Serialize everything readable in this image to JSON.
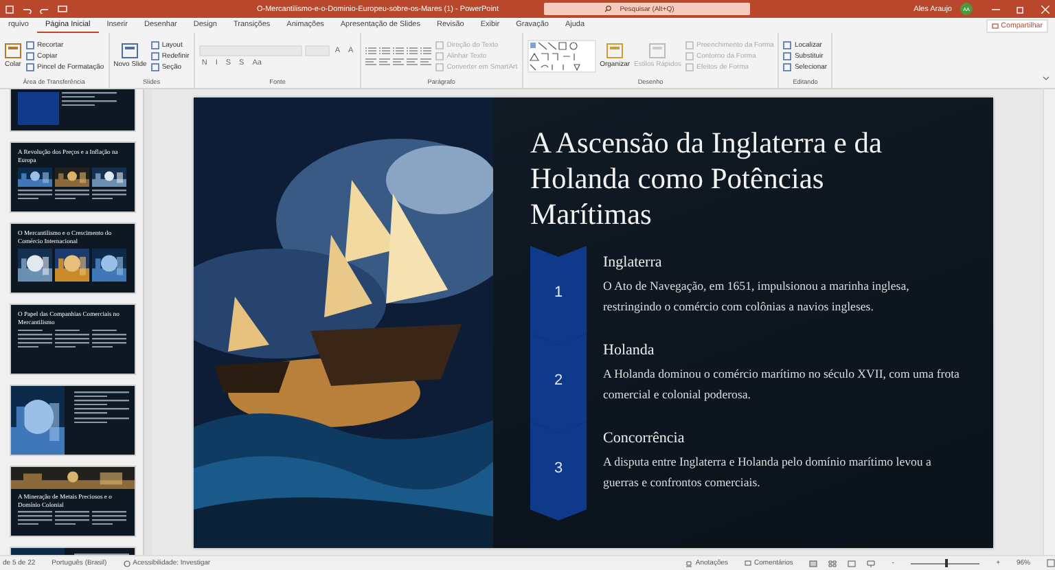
{
  "window": {
    "title": "O-Mercantilismo-e-o-Dominio-Europeu-sobre-os-Mares (1)  -  PowerPoint",
    "search": {
      "placeholder": "Pesquisar (Alt+Q)"
    },
    "user": {
      "name": "Ales Araujo",
      "initials": "AA"
    }
  },
  "tabs": [
    {
      "label": "rquivo",
      "selected": false
    },
    {
      "label": "Página Inicial",
      "selected": true
    },
    {
      "label": "Inserir",
      "selected": false
    },
    {
      "label": "Desenhar",
      "selected": false
    },
    {
      "label": "Design",
      "selected": false
    },
    {
      "label": "Transições",
      "selected": false
    },
    {
      "label": "Animações",
      "selected": false
    },
    {
      "label": "Apresentação de Slides",
      "selected": false
    },
    {
      "label": "Revisão",
      "selected": false
    },
    {
      "label": "Exibir",
      "selected": false
    },
    {
      "label": "Gravação",
      "selected": false
    },
    {
      "label": "Ajuda",
      "selected": false
    }
  ],
  "share_button": "Compartilhar",
  "ribbon": {
    "groups": [
      {
        "kind": "clipboard",
        "label": "Área de Transferência",
        "large": {
          "label": "Colar",
          "disabled": false
        },
        "items": [
          {
            "label": "Recortar",
            "disabled": false
          },
          {
            "label": "Copiar",
            "disabled": false
          },
          {
            "label": "Pincel de Formatação",
            "disabled": false
          }
        ]
      },
      {
        "kind": "slides",
        "label": "Slides",
        "large": {
          "label": "Novo Slide",
          "disabled": false
        },
        "items": [
          {
            "label": "Layout",
            "disabled": false
          },
          {
            "label": "Redefinir",
            "disabled": false
          },
          {
            "label": "Seção",
            "disabled": false
          }
        ]
      },
      {
        "kind": "font",
        "label": "Fonte",
        "glyphs_top": [
          "A",
          "A"
        ],
        "glyphs_bottom": [
          "N",
          "I",
          "S",
          "S",
          "Aa"
        ]
      },
      {
        "kind": "paragraph",
        "label": "Parágrafo",
        "items": [
          {
            "label": "Direção do Texto",
            "disabled": true
          },
          {
            "label": "Alinhar Texto",
            "disabled": true
          },
          {
            "label": "Converter em SmartArt",
            "disabled": true
          }
        ]
      },
      {
        "kind": "drawing",
        "label": "Desenho",
        "large": {
          "label": "Organizar",
          "disabled": false
        },
        "large2": {
          "label": "Estilos Rápidos",
          "disabled": true
        },
        "items": [
          {
            "label": "Preenchimento da Forma",
            "disabled": true
          },
          {
            "label": "Contorno da Forma",
            "disabled": true
          },
          {
            "label": "Efeitos de Forma",
            "disabled": true
          }
        ]
      },
      {
        "kind": "editing",
        "label": "Editando",
        "items": [
          {
            "label": "Localizar",
            "disabled": false
          },
          {
            "label": "Substituir",
            "disabled": false
          },
          {
            "label": "Selecionar",
            "disabled": false
          }
        ]
      }
    ]
  },
  "thumbnails": [
    {
      "kind": "list",
      "selected": false
    },
    {
      "kind": "images3",
      "title": "A Revolução dos Preços e a Inflação na Europa",
      "selected": false
    },
    {
      "kind": "images3_plain",
      "title": "O Mercantilismo e o Crescimento do Comércio Internacional",
      "selected": false
    },
    {
      "kind": "columns3",
      "title": "O Papel das Companhias Comerciais no Mercantilismo",
      "selected": false
    },
    {
      "kind": "image_left",
      "selected": false
    },
    {
      "kind": "banner",
      "title": "A Mineração de Metais Preciosos e o Domínio Colonial",
      "selected": false
    },
    {
      "kind": "image_left",
      "selected": false
    }
  ],
  "slide": {
    "title": "A Ascensão da Inglaterra e da Holanda como Potências Marítimas",
    "steps": [
      {
        "number": "1",
        "heading": "Inglaterra",
        "text": "O Ato de Navegação, em 1651, impulsionou a marinha inglesa, restringindo o comércio com colônias a navios ingleses."
      },
      {
        "number": "2",
        "heading": "Holanda",
        "text": "A Holanda dominou o comércio marítimo no século XVII, com uma frota comercial e colonial poderosa."
      },
      {
        "number": "3",
        "heading": "Concorrência",
        "text": "A disputa entre Inglaterra e Holanda pelo domínio marítimo levou a guerras e confrontos comerciais."
      }
    ]
  },
  "status_bar": {
    "slide_counter": "de 5 de 22",
    "language": "Português (Brasil)",
    "accessibility": "Acessibilidade: Investigar",
    "notes": "Anotações",
    "comments": "Comentários",
    "zoom": "96%",
    "zoom_out": "-",
    "zoom_in": "+",
    "zoom_slider": {
      "level": 0.5
    }
  }
}
